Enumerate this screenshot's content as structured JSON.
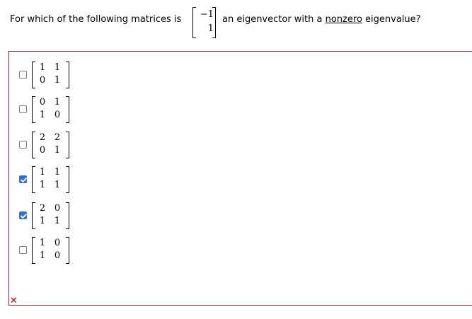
{
  "question": {
    "text_before": "For which of the following matrices is",
    "vector": [
      "−1",
      "1"
    ],
    "text_middle": "an eigenvector with a",
    "text_underlined": "nonzero",
    "text_after": "eigenvalue?"
  },
  "options": [
    {
      "matrix": [
        [
          "1",
          "1"
        ],
        [
          "0",
          "1"
        ]
      ],
      "checked": false
    },
    {
      "matrix": [
        [
          "0",
          "1"
        ],
        [
          "1",
          "0"
        ]
      ],
      "checked": false
    },
    {
      "matrix": [
        [
          "2",
          "2"
        ],
        [
          "0",
          "1"
        ]
      ],
      "checked": false
    },
    {
      "matrix": [
        [
          "1",
          "1"
        ],
        [
          "1",
          "1"
        ]
      ],
      "checked": true
    },
    {
      "matrix": [
        [
          "2",
          "0"
        ],
        [
          "1",
          "1"
        ]
      ],
      "checked": true
    },
    {
      "matrix": [
        [
          "1",
          "0"
        ],
        [
          "1",
          "0"
        ]
      ],
      "checked": false
    }
  ],
  "feedback": {
    "mark": "✕",
    "status": "incorrect",
    "color": "#c00000"
  },
  "colors": {
    "checkbox_checked": "#2f6fd6",
    "box_border": "#8a1a2b"
  }
}
